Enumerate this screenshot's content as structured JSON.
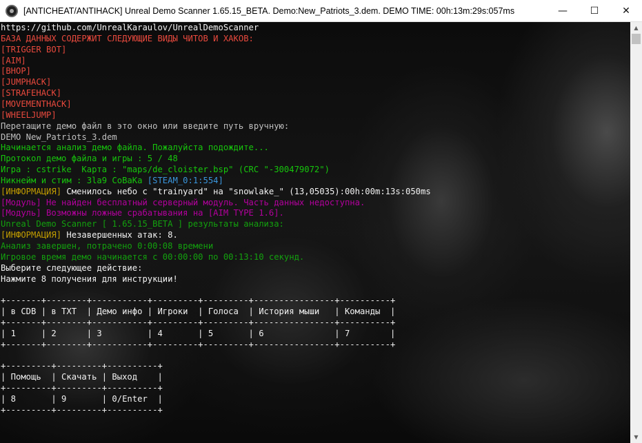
{
  "window": {
    "title": "[ANTICHEAT/ANTIHACK] Unreal Demo Scanner 1.65.15_BETA. Demo:New_Patriots_3.dem. DEMO TIME: 00h:13m:29s:057ms",
    "minimize_glyph": "—",
    "maximize_glyph": "☐",
    "close_glyph": "✕"
  },
  "console": {
    "lines": [
      {
        "segments": [
          {
            "text": "https://github.com/UnrealKaraulov/UnrealDemoScanner",
            "color": "white"
          }
        ]
      },
      {
        "segments": [
          {
            "text": "БАЗА ДАННЫХ СОДЕРЖИТ СЛЕДУЮЩИЕ ВИДЫ ЧИТОВ И ХАКОВ:",
            "color": "red"
          }
        ]
      },
      {
        "segments": [
          {
            "text": "[TRIGGER BOT]",
            "color": "red"
          }
        ]
      },
      {
        "segments": [
          {
            "text": "[AIM]",
            "color": "red"
          }
        ]
      },
      {
        "segments": [
          {
            "text": "[BHOP]",
            "color": "red"
          }
        ]
      },
      {
        "segments": [
          {
            "text": "[JUMPHACK]",
            "color": "red"
          }
        ]
      },
      {
        "segments": [
          {
            "text": "[STRAFEHACK]",
            "color": "red"
          }
        ]
      },
      {
        "segments": [
          {
            "text": "[MOVEMENTHACK]",
            "color": "red"
          }
        ]
      },
      {
        "segments": [
          {
            "text": "[WHEELJUMP]",
            "color": "red"
          }
        ]
      },
      {
        "segments": [
          {
            "text": "Перетащите демо файл в это окно или введите путь вручную:",
            "color": "grey"
          }
        ]
      },
      {
        "segments": [
          {
            "text": "DEMO New_Patriots_3.dem",
            "color": "grey"
          }
        ]
      },
      {
        "segments": [
          {
            "text": "Начинается анализ демо файла. Пожалуйста подождите...",
            "color": "lgreen"
          }
        ]
      },
      {
        "segments": [
          {
            "text": "Протокол демо файла и игры : 5 / 48",
            "color": "lgreen"
          }
        ]
      },
      {
        "segments": [
          {
            "text": "Игра : cstrike  Карта : \"maps/de_cloister.bsp\" (CRC \"-300479072\")",
            "color": "lgreen"
          }
        ]
      },
      {
        "segments": [
          {
            "text": "Никнейм и стим : 3la9 CoBaKa ",
            "color": "lgreen"
          },
          {
            "text": "[STEAM_0:1:554]",
            "color": "cyan"
          }
        ]
      },
      {
        "segments": [
          {
            "text": "[ИНФОРМАЦИЯ]",
            "color": "yellow"
          },
          {
            "text": " Сменилось небо с \"trainyard\" на \"snowlake_\" (13,05035):00h:00m:13s:050ms",
            "color": "white"
          }
        ]
      },
      {
        "segments": [
          {
            "text": "[Модуль] Не найден бесплатный серверный модуль. Часть данных недоступна.",
            "color": "magenta"
          }
        ]
      },
      {
        "segments": [
          {
            "text": "[Модуль] Возможны ложные срабатывания на [AIM TYPE 1.6].",
            "color": "magenta"
          }
        ]
      },
      {
        "segments": [
          {
            "text": "Unreal Demo Scanner [ 1.65.15_BETA ] результаты анализа:",
            "color": "dgreen"
          }
        ]
      },
      {
        "segments": [
          {
            "text": "[ИНФОРМАЦИЯ]",
            "color": "yellow"
          },
          {
            "text": " Незавершенных атак: 8.",
            "color": "white"
          }
        ]
      },
      {
        "segments": [
          {
            "text": "Анализ завершен, потрачено 0:00:08 времени",
            "color": "dgreen"
          }
        ]
      },
      {
        "segments": [
          {
            "text": "Игровое время демо начинается с 00:00:00 по 00:13:10 секунд.",
            "color": "dgreen"
          }
        ]
      },
      {
        "segments": [
          {
            "text": "Выберите следующее действие:",
            "color": "white"
          }
        ]
      },
      {
        "segments": [
          {
            "text": "Нажмите 8 получения для инструкции!",
            "color": "white"
          }
        ]
      },
      {
        "segments": [
          {
            "text": "",
            "color": "white"
          }
        ]
      },
      {
        "segments": [
          {
            "text": "+-------+--------+-----------+---------+---------+----------------+----------+",
            "color": "white"
          }
        ]
      },
      {
        "segments": [
          {
            "text": "| в CDB | в TXT  | Демо инфо | Игроки  | Голоса  | История мыши   | Команды  |",
            "color": "white"
          }
        ]
      },
      {
        "segments": [
          {
            "text": "+-------+--------+-----------+---------+---------+----------------+----------+",
            "color": "white"
          }
        ]
      },
      {
        "segments": [
          {
            "text": "| 1     | 2      | 3         | 4       | 5       | 6              | 7        |",
            "color": "white"
          }
        ]
      },
      {
        "segments": [
          {
            "text": "+-------+--------+-----------+---------+---------+----------------+----------+",
            "color": "white"
          }
        ]
      },
      {
        "segments": [
          {
            "text": "",
            "color": "white"
          }
        ]
      },
      {
        "segments": [
          {
            "text": "+---------+---------+----------+",
            "color": "white"
          }
        ]
      },
      {
        "segments": [
          {
            "text": "| Помощь  | Скачать | Выход    |",
            "color": "white"
          }
        ]
      },
      {
        "segments": [
          {
            "text": "+---------+---------+----------+",
            "color": "white"
          }
        ]
      },
      {
        "segments": [
          {
            "text": "| 8       | 9       | 0/Enter  |",
            "color": "white"
          }
        ]
      },
      {
        "segments": [
          {
            "text": "+---------+---------+----------+",
            "color": "white"
          }
        ]
      }
    ]
  },
  "scrollbar": {
    "up_glyph": "▲",
    "down_glyph": "▼"
  }
}
